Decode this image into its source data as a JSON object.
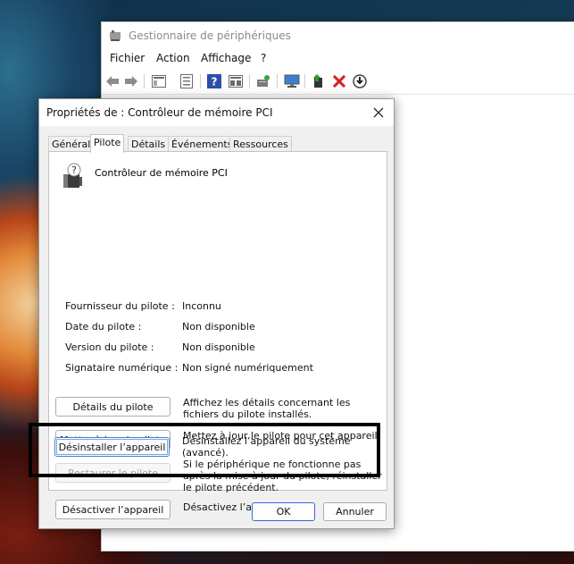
{
  "device_manager": {
    "title": "Gestionnaire de périphériques",
    "menu": [
      "Fichier",
      "Action",
      "Affichage",
      "?"
    ]
  },
  "dialog": {
    "title": "Propriétés de : Contrôleur de mémoire PCI",
    "tabs": [
      "Général",
      "Pilote",
      "Détails",
      "Événements",
      "Ressources"
    ],
    "active_tab": "Pilote",
    "device_name": "Contrôleur de mémoire PCI",
    "fields": [
      {
        "label": "Fournisseur du pilote :",
        "value": "Inconnu"
      },
      {
        "label": "Date du pilote :",
        "value": "Non disponible"
      },
      {
        "label": "Version du pilote :",
        "value": "Non disponible"
      },
      {
        "label": "Signataire numérique :",
        "value": "Non signé numériquement"
      }
    ],
    "actions": [
      {
        "label": "Détails du pilote",
        "description": "Affichez les détails concernant les fichiers du pilote installés.",
        "enabled": true
      },
      {
        "label": "Mettre à jour le pilote",
        "description": "Mettez à jour le pilote pour cet appareil.",
        "enabled": true
      },
      {
        "label": "Restaurer le pilote",
        "description": "Si le périphérique ne fonctionne pas après la mise à jour du pilote, réinstaller le pilote précédent.",
        "enabled": false
      },
      {
        "label": "Désactiver l’appareil",
        "description": "Désactivez l’appareil.",
        "enabled": true
      },
      {
        "label": "Désinstaller l’appareil",
        "description": "Désinstallez l’appareil du système (avancé).",
        "enabled": true
      }
    ],
    "ok_label": "OK",
    "cancel_label": "Annuler"
  },
  "icons": {
    "toolbar": [
      "back-arrow-icon",
      "forward-arrow-icon",
      "properties-pane-icon",
      "device-list-icon",
      "help-icon",
      "view-icon",
      "scan-hardware-icon",
      "computer-icon",
      "update-driver-icon",
      "uninstall-x-icon",
      "download-circle-icon"
    ],
    "accent": "#2f6ed8",
    "uninstall_red": "#d42020",
    "highlight": "#000000"
  }
}
